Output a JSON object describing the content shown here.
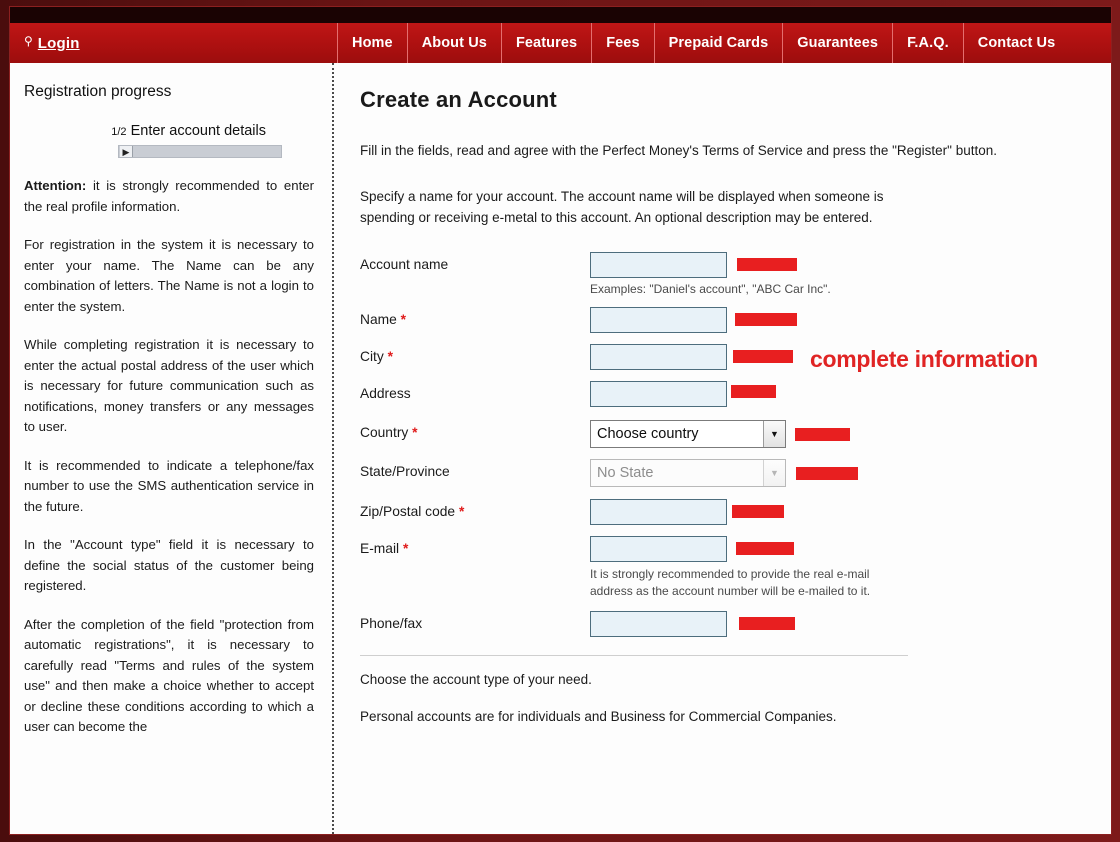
{
  "header": {
    "login_icon": "key-icon",
    "login_label": "Login",
    "nav_items": [
      {
        "label": "Home"
      },
      {
        "label": "About Us"
      },
      {
        "label": "Features"
      },
      {
        "label": "Fees"
      },
      {
        "label": "Prepaid Cards"
      },
      {
        "label": "Guarantees"
      },
      {
        "label": "F.A.Q."
      },
      {
        "label": "Contact Us"
      }
    ]
  },
  "sidebar": {
    "progress_title": "Registration progress",
    "step_fraction": "1/2",
    "step_label": "Enter account details",
    "progress_marker_icon": "play-marker-icon",
    "paragraphs": [
      {
        "lead": "Attention:",
        "text": " it is strongly recommended to enter the real profile information."
      },
      {
        "lead": "",
        "text": "For registration in the system it is necessary to enter your name. The Name can be any combination of letters. The Name is not a login to enter the system."
      },
      {
        "lead": "",
        "text": "While completing registration it is necessary to enter the actual postal address of the user which is necessary for future communication such as notifications, money transfers or any messages to user."
      },
      {
        "lead": "",
        "text": "It is recommended to indicate a telephone/fax number to use the SMS authentication service in the future."
      },
      {
        "lead": "",
        "text": "In the \"Account type\" field it is necessary to define the social status of the customer being registered."
      },
      {
        "lead": "",
        "text": "After the completion of the field \"protection from automatic registrations\", it is necessary to carefully read \"Terms and rules of the system use\" and then make a choice whether to accept or decline these conditions according to which a user can become the"
      }
    ]
  },
  "main": {
    "title": "Create an Account",
    "intro": "Fill in the fields, read and agree with the Perfect Money's Terms of Service and press the \"Register\" button.",
    "description": "Specify a name for your account. The account name will be displayed when someone is spending or receiving e-metal to this account. An optional description may be entered.",
    "annotation": "complete information",
    "fields": {
      "account_name": {
        "label": "Account name",
        "value": "",
        "placeholder": "",
        "hint": "Examples: \"Daniel's account\", \"ABC Car Inc\"."
      },
      "name": {
        "label": "Name",
        "required": "*",
        "value": "",
        "placeholder": ""
      },
      "city": {
        "label": "City",
        "required": "*",
        "value": "",
        "placeholder": ""
      },
      "address": {
        "label": "Address",
        "value": "",
        "placeholder": ""
      },
      "country": {
        "label": "Country",
        "required": "*",
        "selected": "Choose country",
        "arrow_icon": "chevron-down-icon"
      },
      "state": {
        "label": "State/Province",
        "selected": "No State",
        "arrow_icon": "chevron-down-icon"
      },
      "zip": {
        "label": "Zip/Postal code",
        "required": "*",
        "value": "",
        "placeholder": ""
      },
      "email": {
        "label": "E-mail",
        "required": "*",
        "value": "",
        "placeholder": "",
        "hint": "It is strongly recommended to provide the real e-mail address as the account number will be e-mailed to it."
      },
      "phone": {
        "label": "Phone/fax",
        "value": "",
        "placeholder": ""
      }
    },
    "footer_lines": [
      "Choose the account type of your need.",
      "Personal accounts are for individuals and Business for Commercial Companies."
    ]
  },
  "colors": {
    "brand_red": "#b51212",
    "annotation_red": "#e81f20",
    "frame_dark": "#4a0d0d",
    "input_fill": "#e8f2f8",
    "required_star": "#e01b1b"
  }
}
